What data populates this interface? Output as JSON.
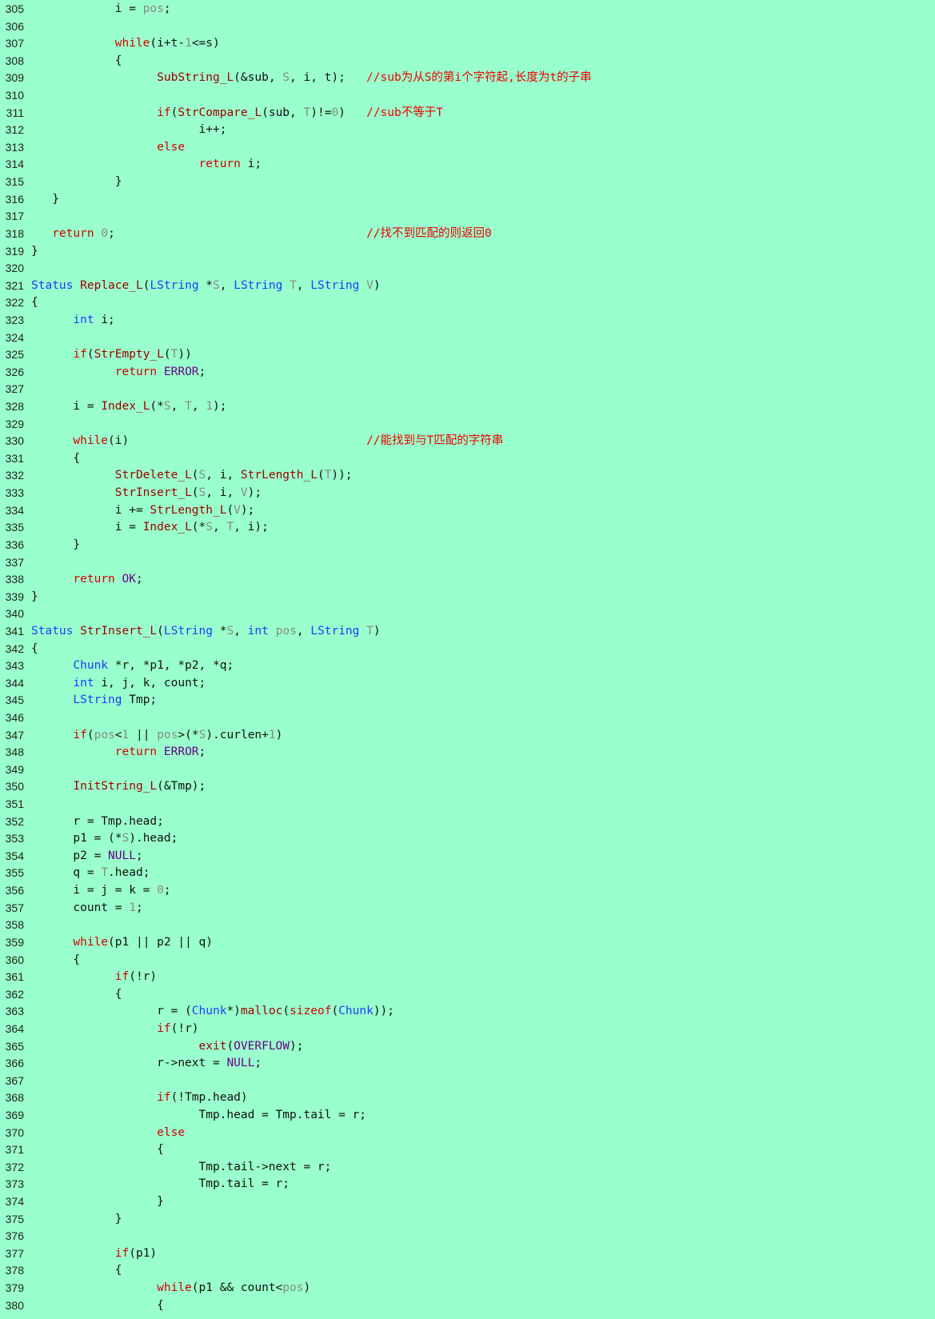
{
  "editor": {
    "background": "#99ffcc",
    "token_colors": {
      "plain": "#111111",
      "keyword": "#d40000",
      "type": "#1a3cff",
      "function": "#a00000",
      "param": "#8a8a8a",
      "macro": "#6a008a",
      "comment": "#ee0000"
    },
    "lines": [
      {
        "n": "305",
        "t": [
          [
            "p",
            "            i = "
          ],
          [
            "n",
            "pos"
          ],
          [
            "p",
            ";"
          ]
        ]
      },
      {
        "n": "306",
        "t": []
      },
      {
        "n": "307",
        "t": [
          [
            "p",
            "            "
          ],
          [
            "k",
            "while"
          ],
          [
            "p",
            "(i+t-"
          ],
          [
            "n",
            "1"
          ],
          [
            "p",
            "<=s)"
          ]
        ]
      },
      {
        "n": "308",
        "t": [
          [
            "p",
            "            {"
          ]
        ]
      },
      {
        "n": "309",
        "t": [
          [
            "p",
            "                  "
          ],
          [
            "f",
            "SubString_L"
          ],
          [
            "p",
            "(&sub, "
          ],
          [
            "n",
            "S"
          ],
          [
            "p",
            ", i, t);   "
          ],
          [
            "c",
            "//sub为从S的第i个字符起,长度为t的子串"
          ]
        ]
      },
      {
        "n": "310",
        "t": []
      },
      {
        "n": "311",
        "t": [
          [
            "p",
            "                  "
          ],
          [
            "k",
            "if"
          ],
          [
            "p",
            "("
          ],
          [
            "f",
            "StrCompare_L"
          ],
          [
            "p",
            "(sub, "
          ],
          [
            "n",
            "T"
          ],
          [
            "p",
            ")!="
          ],
          [
            "n",
            "0"
          ],
          [
            "p",
            ")   "
          ],
          [
            "c",
            "//sub不等于T"
          ]
        ]
      },
      {
        "n": "312",
        "t": [
          [
            "p",
            "                        i++;"
          ]
        ]
      },
      {
        "n": "313",
        "t": [
          [
            "p",
            "                  "
          ],
          [
            "k",
            "else"
          ]
        ]
      },
      {
        "n": "314",
        "t": [
          [
            "p",
            "                        "
          ],
          [
            "k",
            "return"
          ],
          [
            "p",
            " i;"
          ]
        ]
      },
      {
        "n": "315",
        "t": [
          [
            "p",
            "            }"
          ]
        ]
      },
      {
        "n": "316",
        "t": [
          [
            "p",
            "   }"
          ]
        ]
      },
      {
        "n": "317",
        "t": []
      },
      {
        "n": "318",
        "t": [
          [
            "p",
            "   "
          ],
          [
            "k",
            "return"
          ],
          [
            "p",
            " "
          ],
          [
            "n",
            "0"
          ],
          [
            "p",
            ";                                    "
          ],
          [
            "c",
            "//找不到匹配的则返回0"
          ]
        ]
      },
      {
        "n": "319",
        "t": [
          [
            "p",
            "}"
          ]
        ]
      },
      {
        "n": "320",
        "t": []
      },
      {
        "n": "321",
        "t": [
          [
            "t",
            "Status"
          ],
          [
            "p",
            " "
          ],
          [
            "f",
            "Replace_L"
          ],
          [
            "p",
            "("
          ],
          [
            "t",
            "LString"
          ],
          [
            "p",
            " *"
          ],
          [
            "n",
            "S"
          ],
          [
            "p",
            ", "
          ],
          [
            "t",
            "LString"
          ],
          [
            "p",
            " "
          ],
          [
            "n",
            "T"
          ],
          [
            "p",
            ", "
          ],
          [
            "t",
            "LString"
          ],
          [
            "p",
            " "
          ],
          [
            "n",
            "V"
          ],
          [
            "p",
            ")"
          ]
        ]
      },
      {
        "n": "322",
        "t": [
          [
            "p",
            "{"
          ]
        ]
      },
      {
        "n": "323",
        "t": [
          [
            "p",
            "      "
          ],
          [
            "t",
            "int"
          ],
          [
            "p",
            " i;"
          ]
        ]
      },
      {
        "n": "324",
        "t": []
      },
      {
        "n": "325",
        "t": [
          [
            "p",
            "      "
          ],
          [
            "k",
            "if"
          ],
          [
            "p",
            "("
          ],
          [
            "f",
            "StrEmpty_L"
          ],
          [
            "p",
            "("
          ],
          [
            "n",
            "T"
          ],
          [
            "p",
            "))"
          ]
        ]
      },
      {
        "n": "326",
        "t": [
          [
            "p",
            "            "
          ],
          [
            "k",
            "return"
          ],
          [
            "p",
            " "
          ],
          [
            "m",
            "ERROR"
          ],
          [
            "p",
            ";"
          ]
        ]
      },
      {
        "n": "327",
        "t": []
      },
      {
        "n": "328",
        "t": [
          [
            "p",
            "      i = "
          ],
          [
            "f",
            "Index_L"
          ],
          [
            "p",
            "(*"
          ],
          [
            "n",
            "S"
          ],
          [
            "p",
            ", "
          ],
          [
            "n",
            "T"
          ],
          [
            "p",
            ", "
          ],
          [
            "n",
            "1"
          ],
          [
            "p",
            ");"
          ]
        ]
      },
      {
        "n": "329",
        "t": []
      },
      {
        "n": "330",
        "t": [
          [
            "p",
            "      "
          ],
          [
            "k",
            "while"
          ],
          [
            "p",
            "(i)                                  "
          ],
          [
            "c",
            "//能找到与T匹配的字符串"
          ]
        ]
      },
      {
        "n": "331",
        "t": [
          [
            "p",
            "      {"
          ]
        ]
      },
      {
        "n": "332",
        "t": [
          [
            "p",
            "            "
          ],
          [
            "f",
            "StrDelete_L"
          ],
          [
            "p",
            "("
          ],
          [
            "n",
            "S"
          ],
          [
            "p",
            ", i, "
          ],
          [
            "f",
            "StrLength_L"
          ],
          [
            "p",
            "("
          ],
          [
            "n",
            "T"
          ],
          [
            "p",
            "));"
          ]
        ]
      },
      {
        "n": "333",
        "t": [
          [
            "p",
            "            "
          ],
          [
            "f",
            "StrInsert_L"
          ],
          [
            "p",
            "("
          ],
          [
            "n",
            "S"
          ],
          [
            "p",
            ", i, "
          ],
          [
            "n",
            "V"
          ],
          [
            "p",
            ");"
          ]
        ]
      },
      {
        "n": "334",
        "t": [
          [
            "p",
            "            i += "
          ],
          [
            "f",
            "StrLength_L"
          ],
          [
            "p",
            "("
          ],
          [
            "n",
            "V"
          ],
          [
            "p",
            ");"
          ]
        ]
      },
      {
        "n": "335",
        "t": [
          [
            "p",
            "            i = "
          ],
          [
            "f",
            "Index_L"
          ],
          [
            "p",
            "(*"
          ],
          [
            "n",
            "S"
          ],
          [
            "p",
            ", "
          ],
          [
            "n",
            "T"
          ],
          [
            "p",
            ", i);"
          ]
        ]
      },
      {
        "n": "336",
        "t": [
          [
            "p",
            "      }"
          ]
        ]
      },
      {
        "n": "337",
        "t": []
      },
      {
        "n": "338",
        "t": [
          [
            "p",
            "      "
          ],
          [
            "k",
            "return"
          ],
          [
            "p",
            " "
          ],
          [
            "m",
            "OK"
          ],
          [
            "p",
            ";"
          ]
        ]
      },
      {
        "n": "339",
        "t": [
          [
            "p",
            "}"
          ]
        ]
      },
      {
        "n": "340",
        "t": []
      },
      {
        "n": "341",
        "t": [
          [
            "t",
            "Status"
          ],
          [
            "p",
            " "
          ],
          [
            "f",
            "StrInsert_L"
          ],
          [
            "p",
            "("
          ],
          [
            "t",
            "LString"
          ],
          [
            "p",
            " *"
          ],
          [
            "n",
            "S"
          ],
          [
            "p",
            ", "
          ],
          [
            "t",
            "int"
          ],
          [
            "p",
            " "
          ],
          [
            "n",
            "pos"
          ],
          [
            "p",
            ", "
          ],
          [
            "t",
            "LString"
          ],
          [
            "p",
            " "
          ],
          [
            "n",
            "T"
          ],
          [
            "p",
            ")"
          ]
        ]
      },
      {
        "n": "342",
        "t": [
          [
            "p",
            "{"
          ]
        ]
      },
      {
        "n": "343",
        "t": [
          [
            "p",
            "      "
          ],
          [
            "t",
            "Chunk"
          ],
          [
            "p",
            " *r, *p1, *p2, *q;"
          ]
        ]
      },
      {
        "n": "344",
        "t": [
          [
            "p",
            "      "
          ],
          [
            "t",
            "int"
          ],
          [
            "p",
            " i, j, k, count;"
          ]
        ]
      },
      {
        "n": "345",
        "t": [
          [
            "p",
            "      "
          ],
          [
            "t",
            "LString"
          ],
          [
            "p",
            " Tmp;"
          ]
        ]
      },
      {
        "n": "346",
        "t": []
      },
      {
        "n": "347",
        "t": [
          [
            "p",
            "      "
          ],
          [
            "k",
            "if"
          ],
          [
            "p",
            "("
          ],
          [
            "n",
            "pos"
          ],
          [
            "p",
            "<"
          ],
          [
            "n",
            "1"
          ],
          [
            "p",
            " || "
          ],
          [
            "n",
            "pos"
          ],
          [
            "p",
            ">(*"
          ],
          [
            "n",
            "S"
          ],
          [
            "p",
            ").curlen+"
          ],
          [
            "n",
            "1"
          ],
          [
            "p",
            ")"
          ]
        ]
      },
      {
        "n": "348",
        "t": [
          [
            "p",
            "            "
          ],
          [
            "k",
            "return"
          ],
          [
            "p",
            " "
          ],
          [
            "m",
            "ERROR"
          ],
          [
            "p",
            ";"
          ]
        ]
      },
      {
        "n": "349",
        "t": []
      },
      {
        "n": "350",
        "t": [
          [
            "p",
            "      "
          ],
          [
            "f",
            "InitString_L"
          ],
          [
            "p",
            "(&Tmp);"
          ]
        ]
      },
      {
        "n": "351",
        "t": []
      },
      {
        "n": "352",
        "t": [
          [
            "p",
            "      r = Tmp.head;"
          ]
        ]
      },
      {
        "n": "353",
        "t": [
          [
            "p",
            "      p1 = (*"
          ],
          [
            "n",
            "S"
          ],
          [
            "p",
            ").head;"
          ]
        ]
      },
      {
        "n": "354",
        "t": [
          [
            "p",
            "      p2 = "
          ],
          [
            "m",
            "NULL"
          ],
          [
            "p",
            ";"
          ]
        ]
      },
      {
        "n": "355",
        "t": [
          [
            "p",
            "      q = "
          ],
          [
            "n",
            "T"
          ],
          [
            "p",
            ".head;"
          ]
        ]
      },
      {
        "n": "356",
        "t": [
          [
            "p",
            "      i = j = k = "
          ],
          [
            "n",
            "0"
          ],
          [
            "p",
            ";"
          ]
        ]
      },
      {
        "n": "357",
        "t": [
          [
            "p",
            "      count = "
          ],
          [
            "n",
            "1"
          ],
          [
            "p",
            ";"
          ]
        ]
      },
      {
        "n": "358",
        "t": []
      },
      {
        "n": "359",
        "t": [
          [
            "p",
            "      "
          ],
          [
            "k",
            "while"
          ],
          [
            "p",
            "(p1 || p2 || q)"
          ]
        ]
      },
      {
        "n": "360",
        "t": [
          [
            "p",
            "      {"
          ]
        ]
      },
      {
        "n": "361",
        "t": [
          [
            "p",
            "            "
          ],
          [
            "k",
            "if"
          ],
          [
            "p",
            "(!r)"
          ]
        ]
      },
      {
        "n": "362",
        "t": [
          [
            "p",
            "            {"
          ]
        ]
      },
      {
        "n": "363",
        "t": [
          [
            "p",
            "                  r = ("
          ],
          [
            "t",
            "Chunk"
          ],
          [
            "p",
            "*)"
          ],
          [
            "f",
            "malloc"
          ],
          [
            "p",
            "("
          ],
          [
            "k",
            "sizeof"
          ],
          [
            "p",
            "("
          ],
          [
            "t",
            "Chunk"
          ],
          [
            "p",
            "));"
          ]
        ]
      },
      {
        "n": "364",
        "t": [
          [
            "p",
            "                  "
          ],
          [
            "k",
            "if"
          ],
          [
            "p",
            "(!r)"
          ]
        ]
      },
      {
        "n": "365",
        "t": [
          [
            "p",
            "                        "
          ],
          [
            "f",
            "exit"
          ],
          [
            "p",
            "("
          ],
          [
            "m",
            "OVERFLOW"
          ],
          [
            "p",
            ");"
          ]
        ]
      },
      {
        "n": "366",
        "t": [
          [
            "p",
            "                  r->next = "
          ],
          [
            "m",
            "NULL"
          ],
          [
            "p",
            ";"
          ]
        ]
      },
      {
        "n": "367",
        "t": []
      },
      {
        "n": "368",
        "t": [
          [
            "p",
            "                  "
          ],
          [
            "k",
            "if"
          ],
          [
            "p",
            "(!Tmp.head)"
          ]
        ]
      },
      {
        "n": "369",
        "t": [
          [
            "p",
            "                        Tmp.head = Tmp.tail = r;"
          ]
        ]
      },
      {
        "n": "370",
        "t": [
          [
            "p",
            "                  "
          ],
          [
            "k",
            "else"
          ]
        ]
      },
      {
        "n": "371",
        "t": [
          [
            "p",
            "                  {"
          ]
        ]
      },
      {
        "n": "372",
        "t": [
          [
            "p",
            "                        Tmp.tail->next = r;"
          ]
        ]
      },
      {
        "n": "373",
        "t": [
          [
            "p",
            "                        Tmp.tail = r;"
          ]
        ]
      },
      {
        "n": "374",
        "t": [
          [
            "p",
            "                  }"
          ]
        ]
      },
      {
        "n": "375",
        "t": [
          [
            "p",
            "            }"
          ]
        ]
      },
      {
        "n": "376",
        "t": []
      },
      {
        "n": "377",
        "t": [
          [
            "p",
            "            "
          ],
          [
            "k",
            "if"
          ],
          [
            "p",
            "(p1)"
          ]
        ]
      },
      {
        "n": "378",
        "t": [
          [
            "p",
            "            {"
          ]
        ]
      },
      {
        "n": "379",
        "t": [
          [
            "p",
            "                  "
          ],
          [
            "k",
            "while"
          ],
          [
            "p",
            "(p1 && count<"
          ],
          [
            "n",
            "pos"
          ],
          [
            "p",
            ")"
          ]
        ]
      },
      {
        "n": "380",
        "t": [
          [
            "p",
            "                  {"
          ]
        ]
      }
    ]
  }
}
